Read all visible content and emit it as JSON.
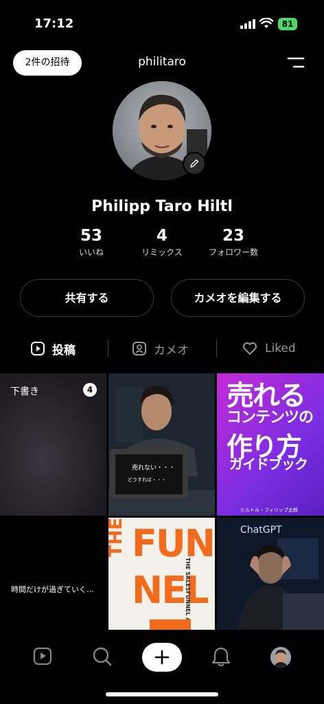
{
  "status_bar": {
    "time": "17:12",
    "battery": "81"
  },
  "header": {
    "invite_label": "2件の招待",
    "username": "philitaro"
  },
  "profile": {
    "name": "Philipp Taro Hiltl",
    "stats": [
      {
        "value": "53",
        "label": "いいね"
      },
      {
        "value": "4",
        "label": "リミックス"
      },
      {
        "value": "23",
        "label": "フォロワー数"
      }
    ]
  },
  "actions": {
    "share": "共有する",
    "edit_cameo": "カメオを編集する"
  },
  "tabs": [
    {
      "label": "投稿",
      "icon": "play-square-icon"
    },
    {
      "label": "カメオ",
      "icon": "person-square-icon"
    },
    {
      "label": "Liked",
      "icon": "heart-icon"
    }
  ],
  "grid": {
    "draft_label": "下書き",
    "draft_count": "4",
    "laptop_line1": "売れない・・・",
    "laptop_line2": "どうすれば・・・",
    "book1_title_lines": [
      "売れる",
      "コンテンツの",
      "作り方",
      "ガイドブック"
    ],
    "book1_author": "ヒルトル・フィリップ太郎",
    "text_tile": "時間だけが過ぎていく…",
    "funnel_vertical": "THE",
    "funnel_lines": [
      "FUN",
      "NEL"
    ],
    "funnel_subtitle": "THE SALESFUNNEL AUTOMATION GUIDEBOOK",
    "chatgpt_label": "ChatGPT"
  },
  "colors": {
    "accent_green": "#4cd964",
    "book_purple": "#8e2de2",
    "funnel_orange": "#f26a1b"
  }
}
